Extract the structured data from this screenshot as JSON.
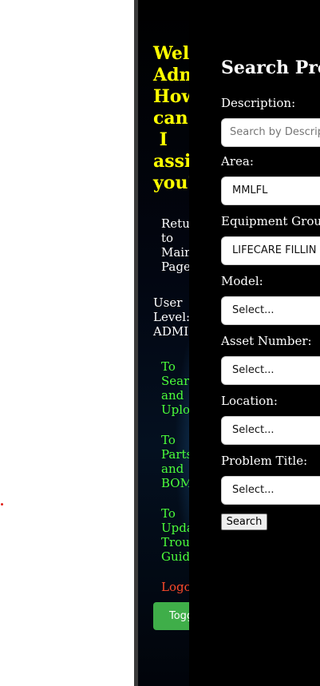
{
  "sidebar": {
    "welcome": "Welc\nAdm\nHow\ncan\n I\nassis\nyou?",
    "return_main": "Retur\nto\nMain\nPage",
    "user_level": "User\nLevel:\nADMI",
    "to_search": "To\nSearc\nand\nUplo",
    "to_parts": "To\nParts\nand\nBOM",
    "to_update": "To\nUpda\nTroub\nGuid",
    "logout": "Logo",
    "toggle_label": "Togg"
  },
  "main": {
    "title": "Search Prob",
    "description_label": "Description:",
    "description_placeholder": "Search by Descripti",
    "area_label": "Area:",
    "area_value": "MMLFL",
    "equipment_group_label": "Equipment Group:",
    "equipment_group_value": "LIFECARE FILLIN",
    "model_label": "Model:",
    "model_value": "Select...",
    "asset_number_label": "Asset Number:",
    "asset_number_value": "Select...",
    "location_label": "Location:",
    "location_value": "Select...",
    "problem_title_label": "Problem Title:",
    "problem_title_value": "Select...",
    "search_button": "Search"
  },
  "colors": {
    "welcome": "#ffff00",
    "nav_link": "#4cff3a",
    "logout": "#ff4a2a",
    "toggle_button": "#3fae49"
  }
}
